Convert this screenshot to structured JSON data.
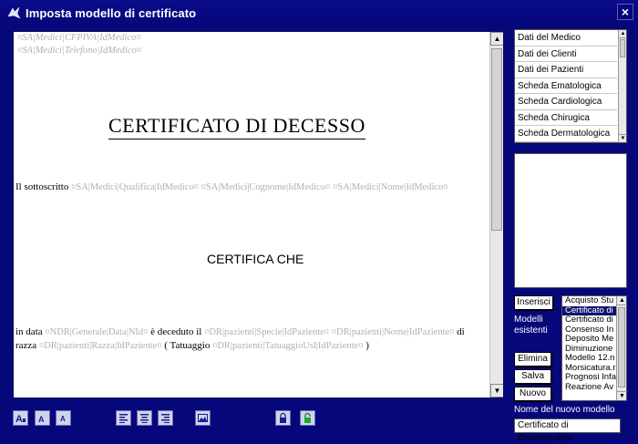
{
  "window": {
    "title": "Imposta modello di certificato",
    "close_label": "×"
  },
  "editor": {
    "header_lines": [
      "¤SA|Medici|CFPIVA|IdMedico¤",
      "¤SA|Medici|Telefono|IdMedico¤"
    ],
    "title": "CERTIFICATO DI DECESSO",
    "para1_text": "Il sottoscritto",
    "para1_fields": [
      "¤SA|Medici|Qualifica|IdMedico¤",
      "¤SA|Medici|Cognome|IdMedico¤",
      "¤SA|Medici|Nome|IdMedico¤"
    ],
    "certifica": "CERTIFICA CHE",
    "para2": {
      "t1": "in data",
      "f1": "¤NDR|Generale|Data|NId¤",
      "t2": "è deceduto il",
      "f2": "¤DR|pazienti|Specie|IdPaziente¤",
      "f3": "¤DR|pazienti|Nome|IdPaziente¤",
      "t3": "di razza",
      "f4": "¤DR|pazienti|Razza|IdPaziente¤",
      "t4": "( Tatuaggio",
      "f5": "¤DR|pazienti|TatuaggioUsl|IdPaziente¤",
      "t5": ")"
    }
  },
  "sections_list": [
    "Dati del Medico",
    "Dati dei Clienti",
    "Dati dei Pazienti",
    "Scheda Ematologica",
    "Scheda Cardiologica",
    "Scheda Chirugica",
    "Scheda Dermatologica"
  ],
  "buttons": {
    "inserisci": "Inserisci",
    "elimina": "Elimina",
    "salva": "Salva",
    "nuovo": "Nuovo"
  },
  "labels": {
    "modelli_esistenti": "Modelli esistenti",
    "nome_nuovo_modello": "Nome del nuovo  modello"
  },
  "models_list": [
    "Acquisto Stu",
    "Certificato di",
    "Certificato di",
    "Consenso In",
    "Deposito Me",
    "Diminuzione",
    "Modello 12.n",
    "Morsicatura.r",
    "Prognosi Infa",
    "Reazione Av"
  ],
  "models_selected_index": 1,
  "new_model_name": "Certificato di Decesso.mcv",
  "toolbar_icons": [
    "font-large-icon",
    "font-medium-icon",
    "font-small-icon",
    "align-left-icon",
    "align-center-icon",
    "align-right-icon",
    "image-icon",
    "lock-icon",
    "unlock-icon"
  ],
  "colors": {
    "background": "#06077a",
    "placeholder_text": "#b0b0b0",
    "selection": "#10126e"
  }
}
